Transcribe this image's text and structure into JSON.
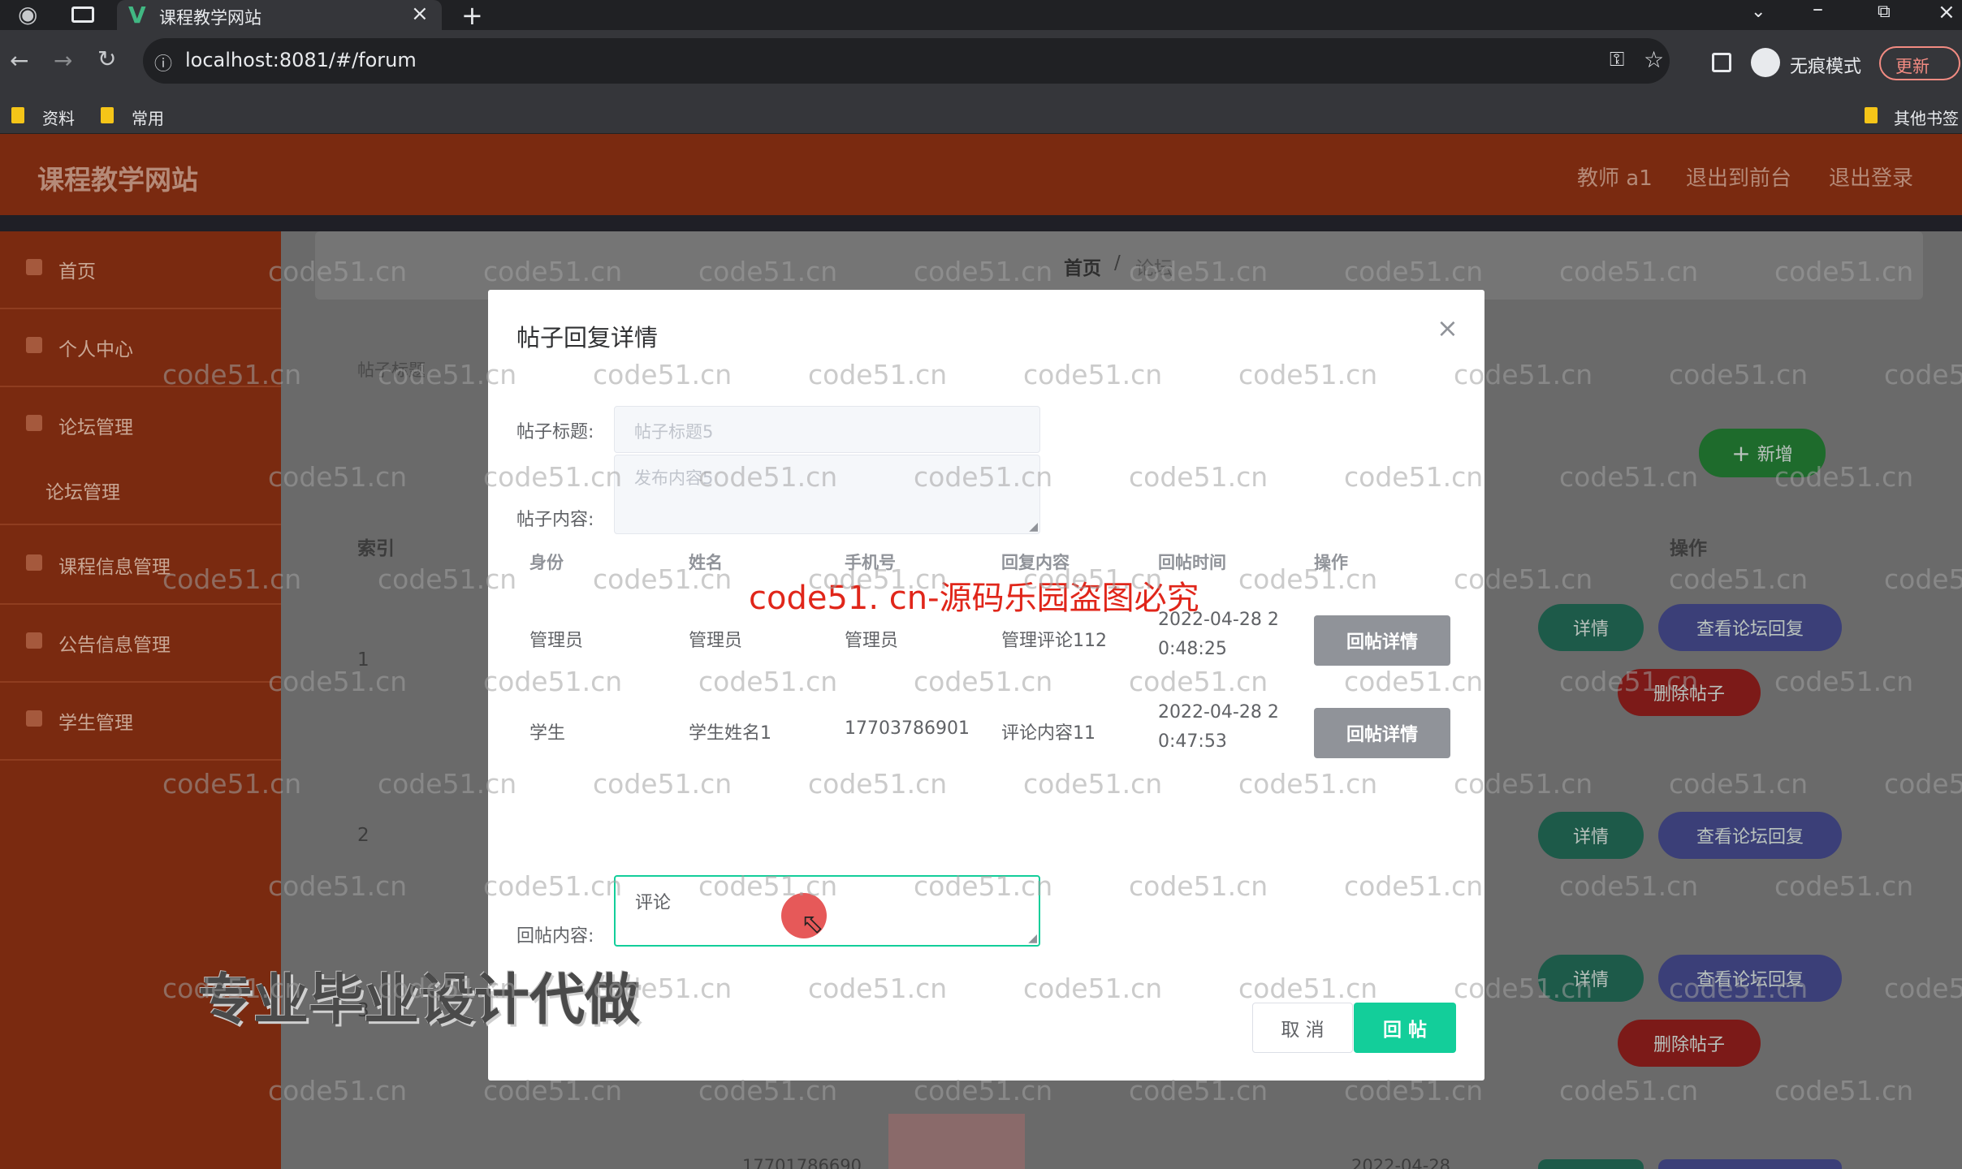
{
  "browser": {
    "tab_title": "课程教学网站",
    "url": "localhost:8081/#/forum",
    "incognito_label": "无痕模式",
    "update_label": "更新",
    "bookmarks": [
      "资料",
      "常用"
    ],
    "other_bookmarks": "其他书签"
  },
  "app": {
    "title": "课程教学网站",
    "user": "教师 a1",
    "back_front": "退出到前台",
    "logout": "退出登录"
  },
  "sidebar": {
    "items": [
      {
        "label": "首页"
      },
      {
        "label": "个人中心"
      },
      {
        "label": "论坛管理"
      },
      {
        "label": "论坛管理"
      },
      {
        "label": "课程信息管理"
      },
      {
        "label": "公告信息管理"
      },
      {
        "label": "学生管理"
      }
    ]
  },
  "breadcrumb": {
    "home": "首页",
    "sep": "/",
    "current": "论坛"
  },
  "background": {
    "search_label": "帖子标题",
    "add_button": "新增",
    "col_index": "索引",
    "col_op": "操作",
    "rows": [
      "1",
      "2",
      "3"
    ],
    "detail": "详情",
    "view_replies": "查看论坛回复",
    "delete": "删除帖子",
    "phone_partial": "17701786690",
    "date_partial": "2022-04-28"
  },
  "dialog": {
    "title": "帖子回复详情",
    "post_title_label": "帖子标题:",
    "post_title_placeholder": "帖子标题5",
    "post_content_label": "帖子内容:",
    "post_content_placeholder": "发布内容5",
    "table": {
      "headers": [
        "身份",
        "姓名",
        "手机号",
        "回复内容",
        "回帖时间",
        "操作"
      ],
      "rows": [
        {
          "role": "管理员",
          "name": "管理员",
          "phone": "管理员",
          "content": "管理评论112",
          "time_line1": "2022-04-28 2",
          "time_line2": "0:48:25",
          "action": "回帖详情"
        },
        {
          "role": "学生",
          "name": "学生姓名1",
          "phone": "17703786901",
          "content": "评论内容11",
          "time_line1": "2022-04-28 2",
          "time_line2": "0:47:53",
          "action": "回帖详情"
        }
      ]
    },
    "reply_label": "回帖内容:",
    "reply_value": "评论",
    "cancel": "取 消",
    "submit": "回 帖"
  },
  "overlay": {
    "red_watermark": "code51. cn-源码乐园盗图必究",
    "promo": "专业毕业设计代做",
    "watermark": "code51.cn"
  },
  "colors": {
    "header": "#7a2a10",
    "primary_green": "#13ce9a",
    "red_text": "#e0261a"
  }
}
